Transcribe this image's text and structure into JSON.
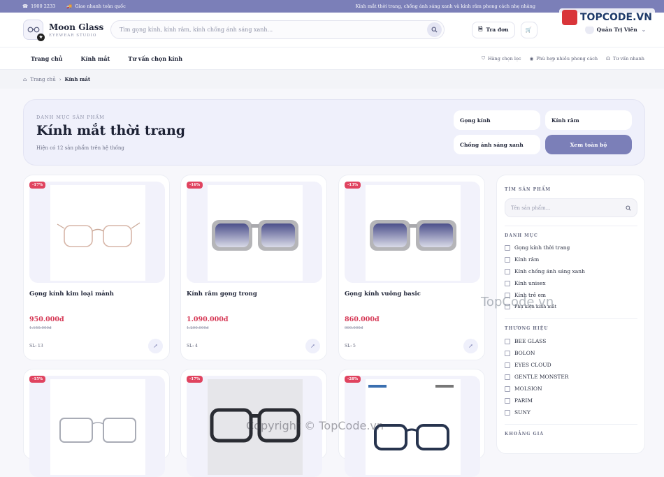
{
  "topbar": {
    "phone": "1900 2233",
    "shipping": "Giao nhanh toàn quốc",
    "tagline": "Kính mắt thời trang, chống ánh sáng xanh và kính râm phong cách nhẹ nhàng"
  },
  "brand": {
    "name": "Moon Glass",
    "sub": "EYEWEAR STUDIO"
  },
  "search": {
    "placeholder": "Tìm gọng kính, kính râm, kính chống ánh sáng xanh..."
  },
  "header": {
    "track_label": "Tra đơn",
    "user_name": "Quản Trị Viên"
  },
  "nav": {
    "items": [
      "Trang chủ",
      "Kính mắt",
      "Tư vấn chọn kính"
    ],
    "features": [
      "Hàng chọn lọc",
      "Phù hợp nhiều phong cách",
      "Tư vấn nhanh"
    ]
  },
  "breadcrumb": {
    "home": "Trang chủ",
    "current": "Kính mắt"
  },
  "banner": {
    "eyebrow": "DANH MỤC SẢN PHẨM",
    "title": "Kính mắt thời trang",
    "subtitle": "Hiện có 12 sản phẩm trên hệ thống",
    "buttons": [
      "Gọng kính",
      "Kính râm",
      "Chống ánh sáng xanh",
      "Xem toàn bộ"
    ]
  },
  "products": [
    {
      "discount": "-17%",
      "name": "Gọng kính kim loại mảnh",
      "price": "950.000đ",
      "old_price": "1.150.000đ",
      "qty": "SL: 13"
    },
    {
      "discount": "-16%",
      "name": "Kính râm gọng trong",
      "price": "1.090.000đ",
      "old_price": "1.290.000đ",
      "qty": "SL: 4"
    },
    {
      "discount": "-13%",
      "name": "Gọng kính vuông basic",
      "price": "860.000đ",
      "old_price": "990.000đ",
      "qty": "SL: 5"
    },
    {
      "discount": "-15%"
    },
    {
      "discount": "-17%"
    },
    {
      "discount": "-28%"
    }
  ],
  "sidebar": {
    "search_heading": "TÌM SẢN PHẨM",
    "search_placeholder": "Tên sản phẩm...",
    "category_heading": "DANH MỤC",
    "categories": [
      "Gọng kính thời trang",
      "Kính râm",
      "Kính chống ánh sáng xanh",
      "Kính unisex",
      "Kính trẻ em",
      "Phụ kiện kính mắt"
    ],
    "brand_heading": "THƯƠNG HIỆU",
    "brands": [
      "BEE GLASS",
      "BOLON",
      "EYES CLOUD",
      "GENTLE MONSTER",
      "MOLSION",
      "PARIM",
      "SUNY"
    ],
    "price_heading": "KHOẢNG GIÁ"
  },
  "watermarks": {
    "logo": "TOPCODE.VN",
    "center": "TopCode.vn",
    "bottom": "Copyright © TopCode.vn"
  },
  "colors": {
    "accent": "#7b7fb8",
    "discount": "#e0435f",
    "price": "#d63956"
  }
}
